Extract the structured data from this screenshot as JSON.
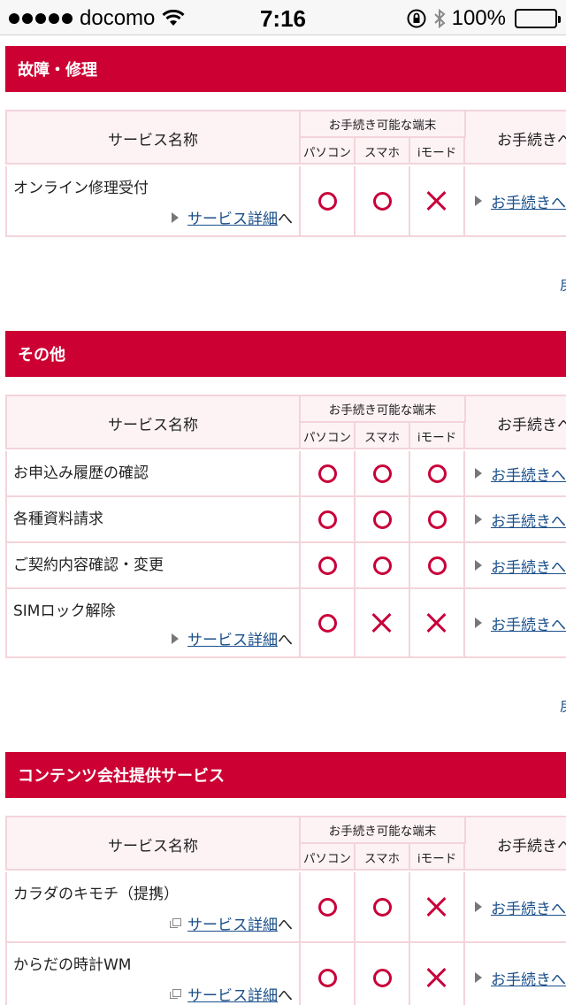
{
  "status_bar": {
    "carrier": "docomo",
    "time": "7:16",
    "battery": "100%"
  },
  "table_header": {
    "name_col": "サービス名称",
    "devices": "お手続き可能な端末",
    "pc": "パソコン",
    "smartphone": "スマホ",
    "imode": "iモード",
    "procedure_col": "お手続きへ"
  },
  "sections": [
    {
      "title": "故障・修理",
      "rows": [
        {
          "name": "オンライン修理受付",
          "detail": "サービス詳細",
          "detail_suffix": "へ",
          "pc": "circle",
          "smartphone": "circle",
          "imode": "cross",
          "procedure": "お手続きへ"
        }
      ],
      "top_link": "戻る"
    },
    {
      "title": "その他",
      "rows": [
        {
          "name": "お申込み履歴の確認",
          "pc": "circle",
          "smartphone": "circle",
          "imode": "circle",
          "procedure": "お手続きへ"
        },
        {
          "name": "各種資料請求",
          "pc": "circle",
          "smartphone": "circle",
          "imode": "circle",
          "procedure": "お手続きへ"
        },
        {
          "name": "ご契約内容確認・変更",
          "pc": "circle",
          "smartphone": "circle",
          "imode": "circle",
          "procedure": "お手続きへ"
        },
        {
          "name": "SIMロック解除",
          "detail": "サービス詳細",
          "detail_suffix": "へ",
          "pc": "circle",
          "smartphone": "cross",
          "imode": "cross",
          "procedure": "お手続きへ"
        }
      ],
      "top_link": "戻る"
    },
    {
      "title": "コンテンツ会社提供サービス",
      "rows": [
        {
          "name": "カラダのキモチ（提携）",
          "detail": "サービス詳細",
          "detail_suffix": "へ",
          "pc": "circle",
          "smartphone": "circle",
          "imode": "cross",
          "procedure": "お手続きへ"
        },
        {
          "name": "からだの時計WM",
          "detail": "サービス詳細",
          "detail_suffix": "へ",
          "pc": "circle",
          "smartphone": "circle",
          "imode": "cross",
          "procedure": "お手続きへ"
        }
      ]
    }
  ],
  "colors": {
    "accent": "#cc0033",
    "mark": "#c8003a",
    "link": "#1a4f8a",
    "border": "#f3d4da"
  }
}
